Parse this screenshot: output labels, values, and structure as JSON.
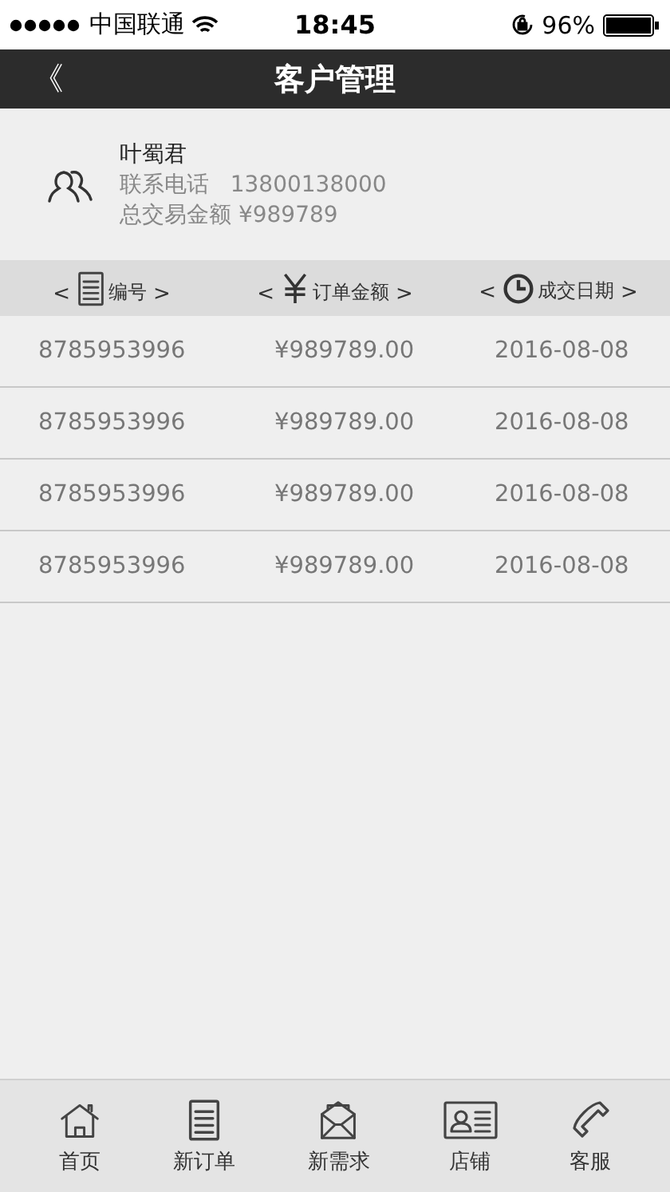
{
  "status_bar": {
    "carrier": "中国联通",
    "time": "18:45",
    "battery": "96%"
  },
  "nav": {
    "back": "《",
    "title": "客户管理"
  },
  "customer": {
    "name": "叶蜀君",
    "phone_label": "联系电话",
    "phone": "13800138000",
    "total_label": "总交易金额",
    "total": "¥989789"
  },
  "table": {
    "columns": [
      {
        "kind": "document",
        "prev": "<",
        "label": "编号",
        "next": ">"
      },
      {
        "kind": "yen",
        "prev": "<",
        "label": "订单金额",
        "next": ">"
      },
      {
        "kind": "clock",
        "prev": "<",
        "label": "成交日期",
        "next": ">"
      }
    ],
    "rows": [
      [
        "8785953996",
        "¥989789.00",
        "2016-08-08"
      ],
      [
        "8785953996",
        "¥989789.00",
        "2016-08-08"
      ],
      [
        "8785953996",
        "¥989789.00",
        "2016-08-08"
      ],
      [
        "8785953996",
        "¥989789.00",
        "2016-08-08"
      ]
    ]
  },
  "tab_bar": [
    {
      "kind": "home",
      "label": "首页"
    },
    {
      "kind": "document",
      "label": "新订单"
    },
    {
      "kind": "envelope",
      "label": "新需求"
    },
    {
      "kind": "card",
      "label": "店铺"
    },
    {
      "kind": "phone",
      "label": "客服"
    }
  ]
}
